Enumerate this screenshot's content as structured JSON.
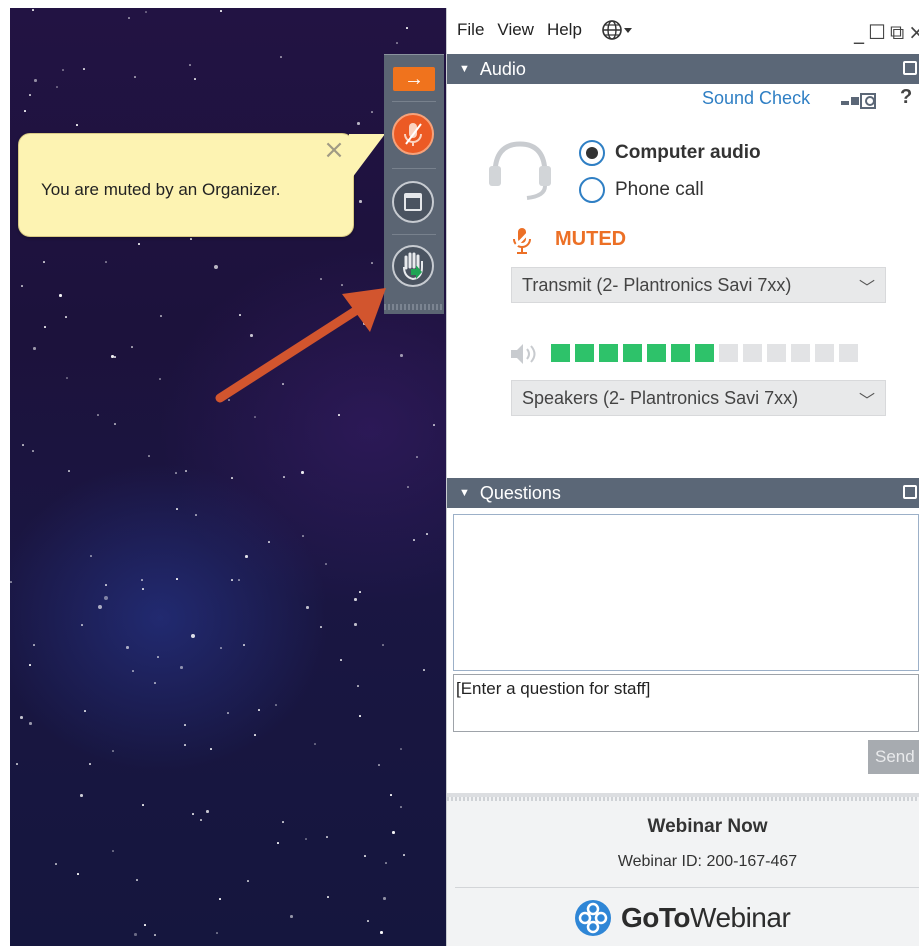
{
  "menu": {
    "items": [
      "File",
      "View",
      "Help"
    ],
    "language_icon": "globe-icon"
  },
  "window_controls": [
    "_",
    "☐",
    "⧉",
    "×"
  ],
  "notification": {
    "message": "You are muted by an Organizer.",
    "close_symbol": "×"
  },
  "grab_tab": {
    "collapse_symbol": "→",
    "buttons": [
      "collapse-arrow-icon",
      "microphone-muted-icon",
      "window-icon",
      "raise-hand-icon"
    ]
  },
  "audio": {
    "section_title": "Audio",
    "sound_check_label": "Sound Check",
    "help_label": "?",
    "modes": [
      {
        "label": "Computer audio",
        "selected": true
      },
      {
        "label": "Phone call",
        "selected": false
      }
    ],
    "mute_status": "MUTED",
    "transmit_device": "Transmit (2- Plantronics Savi 7xx)",
    "speaker_device": "Speakers (2- Plantronics Savi 7xx)",
    "speaker_level": {
      "lit": 7,
      "total": 13
    },
    "colors": {
      "muted": "#ec7026",
      "level": "#2ec26a",
      "link": "#2f7fc4"
    }
  },
  "questions": {
    "section_title": "Questions",
    "input_text": "[Enter a question for staff]",
    "send_label": "Send"
  },
  "footer": {
    "webinar_title": "Webinar Now",
    "webinar_id": "Webinar ID: 200-167-467",
    "brand_bold": "GoTo",
    "brand_light": "Webinar"
  }
}
